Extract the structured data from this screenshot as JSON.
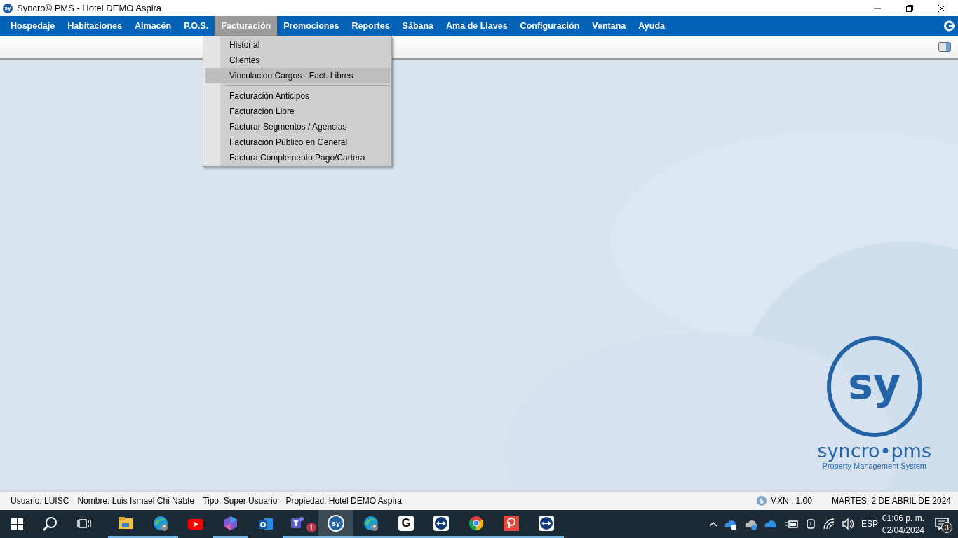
{
  "window": {
    "icon_text": "sy",
    "title": "Syncro© PMS - Hotel DEMO Aspira"
  },
  "menu": [
    {
      "label": "Hospedaje",
      "selected": false
    },
    {
      "label": "Habitaciones",
      "selected": false
    },
    {
      "label": "Almacén",
      "selected": false
    },
    {
      "label": "P.O.S.",
      "selected": false
    },
    {
      "label": "Facturación",
      "selected": true
    },
    {
      "label": "Promociones",
      "selected": false
    },
    {
      "label": "Reportes",
      "selected": false
    },
    {
      "label": "Sábana",
      "selected": false
    },
    {
      "label": "Ama de Llaves",
      "selected": false
    },
    {
      "label": "Configuración",
      "selected": false
    },
    {
      "label": "Ventana",
      "selected": false
    },
    {
      "label": "Ayuda",
      "selected": false
    }
  ],
  "dropdown": {
    "groups": [
      [
        {
          "label": "Historial",
          "selected": false
        },
        {
          "label": "Clientes",
          "selected": false
        },
        {
          "label": "Vinculacion Cargos - Fact. Libres",
          "selected": true
        }
      ],
      [
        {
          "label": "Facturación Anticipos",
          "selected": false
        },
        {
          "label": "Facturación Libre",
          "selected": false
        },
        {
          "label": "Facturar Segmentos / Agencias",
          "selected": false
        },
        {
          "label": "Facturación Público en General",
          "selected": false
        },
        {
          "label": "Factura Complemento Pago/Cartera",
          "selected": false
        }
      ]
    ]
  },
  "logo": {
    "mark": "sy",
    "name": "syncro•pms",
    "tagline": "Property Management System"
  },
  "status_bar": {
    "fields": [
      "Usuario: LUISC",
      "Nombre: Luis Ismael Chi Nabte",
      "Tipo: Super Usuario",
      "Propiedad: Hotel DEMO Aspira"
    ],
    "currency": "MXN : 1.00",
    "date": "MARTES, 2 DE ABRIL DE 2024"
  },
  "taskbar": {
    "apps": [
      {
        "kind": "explorer",
        "running": true,
        "active": false
      },
      {
        "kind": "edge",
        "running": true,
        "active": false
      },
      {
        "kind": "youtube",
        "running": false,
        "active": false
      },
      {
        "kind": "copilot",
        "running": true,
        "active": false
      },
      {
        "kind": "outlook",
        "running": false,
        "active": false
      },
      {
        "kind": "teams",
        "running": true,
        "active": false,
        "badge": "1"
      },
      {
        "kind": "syncro",
        "running": true,
        "active": true,
        "text": "sy"
      },
      {
        "kind": "edge",
        "running": true,
        "active": false
      },
      {
        "kind": "grammar",
        "running": true,
        "active": false,
        "text": "G"
      },
      {
        "kind": "teamviewer",
        "running": true,
        "active": false
      },
      {
        "kind": "chrome",
        "running": true,
        "active": false
      },
      {
        "kind": "parking",
        "running": true,
        "active": false
      },
      {
        "kind": "teamviewer",
        "running": true,
        "active": false
      }
    ],
    "language": "ESP",
    "time": "01:06 p. m.",
    "date": "02/04/2024",
    "notifications": "3"
  }
}
